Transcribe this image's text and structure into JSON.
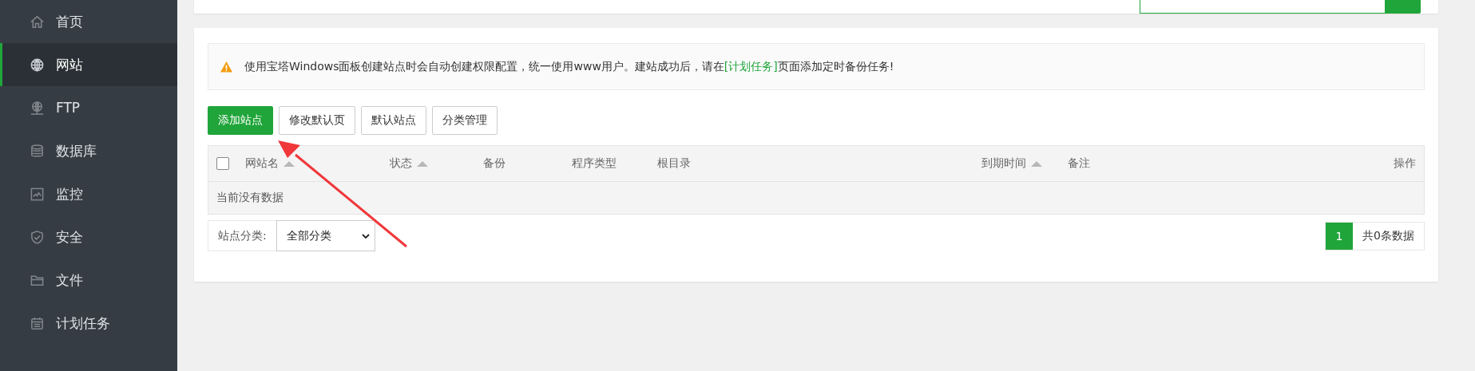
{
  "sidebar": {
    "items": [
      {
        "label": "首页",
        "selected": false
      },
      {
        "label": "网站",
        "selected": true
      },
      {
        "label": "FTP",
        "selected": false
      },
      {
        "label": "数据库",
        "selected": false
      },
      {
        "label": "监控",
        "selected": false
      },
      {
        "label": "安全",
        "selected": false
      },
      {
        "label": "文件",
        "selected": false
      },
      {
        "label": "计划任务",
        "selected": false
      }
    ]
  },
  "notice": {
    "text": "使用宝塔Windows面板创建站点时会自动创建权限配置，统一使用www用户。建站成功后，请在",
    "link": "[计划任务]",
    "suffix": "页面添加定时备份任务!"
  },
  "buttons": [
    {
      "label": "添加站点",
      "kind": "primary"
    },
    {
      "label": "修改默认页",
      "kind": "default"
    },
    {
      "label": "默认站点",
      "kind": "default"
    },
    {
      "label": "分类管理",
      "kind": "default"
    }
  ],
  "table": {
    "select_all_checked": false,
    "columns": [
      {
        "label": "网站名",
        "sortable": true
      },
      {
        "label": "状态",
        "sortable": true
      },
      {
        "label": "备份",
        "sortable": false
      },
      {
        "label": "程序类型",
        "sortable": false
      },
      {
        "label": "根目录",
        "sortable": false
      },
      {
        "label": "到期时间",
        "sortable": true
      },
      {
        "label": "备注",
        "sortable": false
      },
      {
        "label": "操作",
        "sortable": false
      }
    ],
    "empty_message": "当前没有数据"
  },
  "filter": {
    "label": "站点分类:",
    "value": "全部分类"
  },
  "pagination": {
    "pages": [
      {
        "label": "1",
        "selected": true
      }
    ],
    "summary": "共0条数据"
  }
}
